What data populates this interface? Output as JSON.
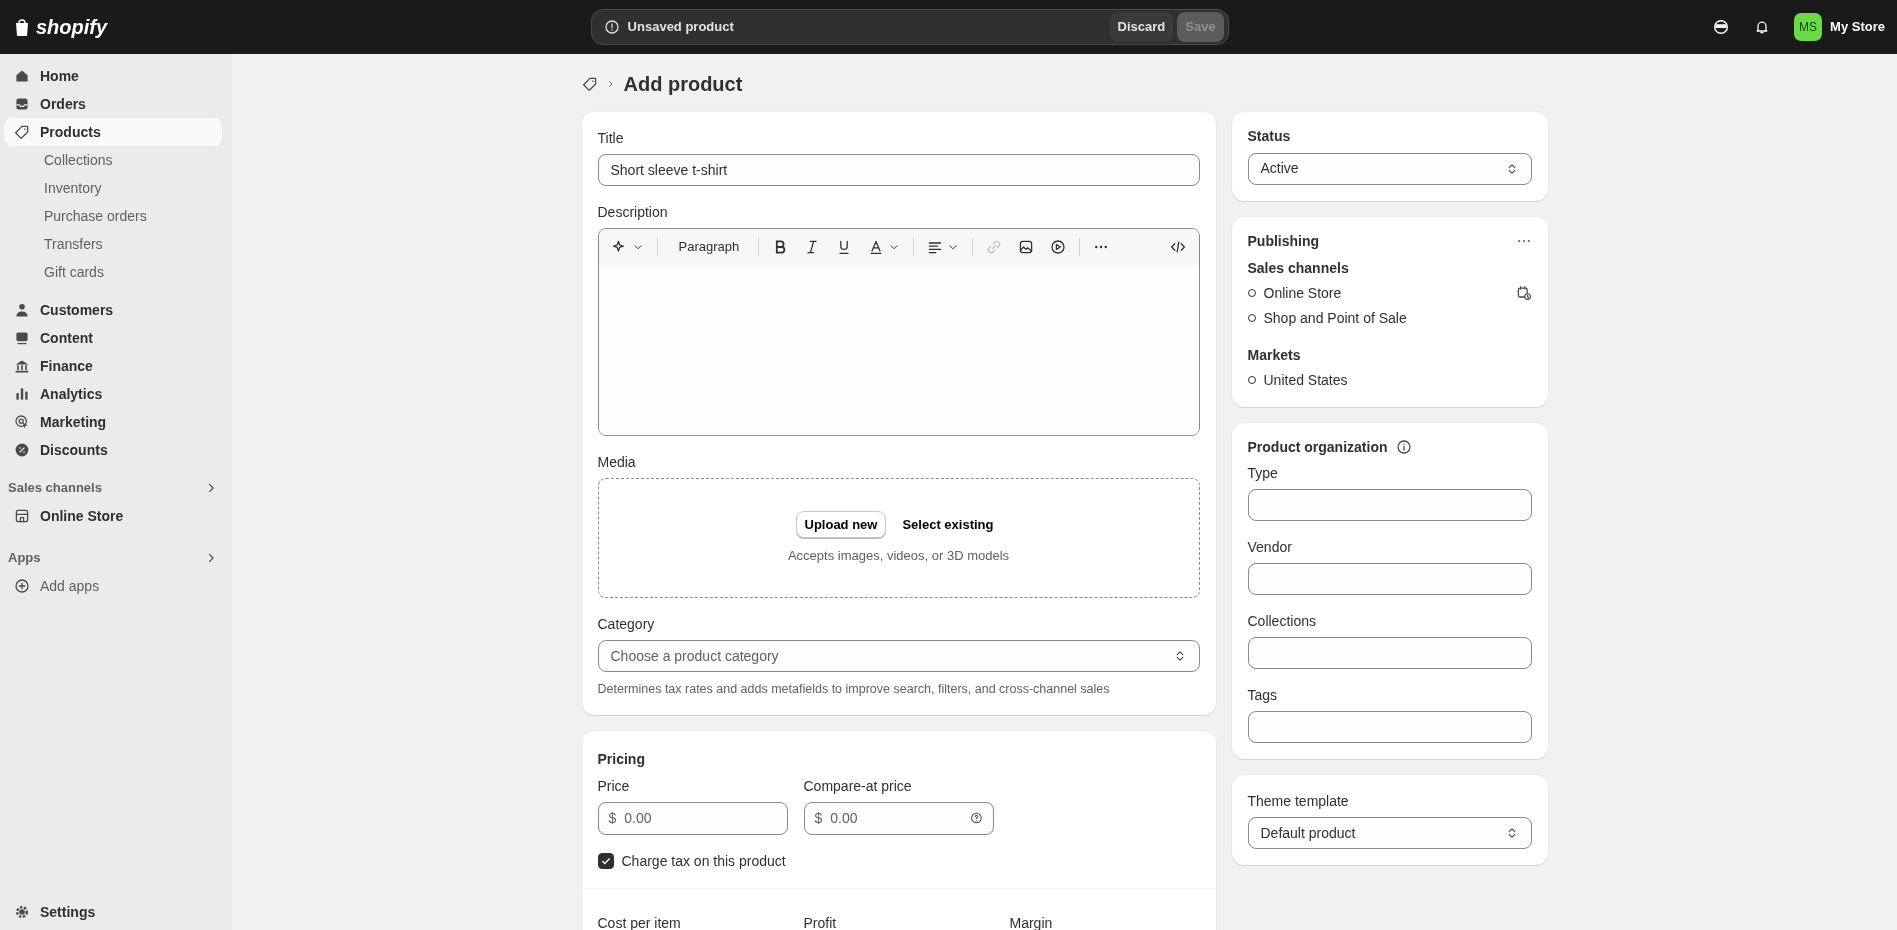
{
  "topbar": {
    "logo": "shopify",
    "unsaved": {
      "message": "Unsaved product",
      "discard": "Discard",
      "save": "Save",
      "save_disabled": true
    },
    "store": {
      "initials": "MS",
      "name": "My Store"
    }
  },
  "sidebar": {
    "items": [
      {
        "label": "Home",
        "kind": "main",
        "selected": false
      },
      {
        "label": "Orders",
        "kind": "main",
        "selected": false
      },
      {
        "label": "Products",
        "kind": "main",
        "selected": true
      },
      {
        "label": "Collections",
        "kind": "sub",
        "selected": false
      },
      {
        "label": "Inventory",
        "kind": "sub",
        "selected": false
      },
      {
        "label": "Purchase orders",
        "kind": "sub",
        "selected": false
      },
      {
        "label": "Transfers",
        "kind": "sub",
        "selected": false
      },
      {
        "label": "Gift cards",
        "kind": "sub",
        "selected": false
      },
      {
        "label": "Customers",
        "kind": "main",
        "selected": false
      },
      {
        "label": "Content",
        "kind": "main",
        "selected": false
      },
      {
        "label": "Finance",
        "kind": "main",
        "selected": false
      },
      {
        "label": "Analytics",
        "kind": "main",
        "selected": false
      },
      {
        "label": "Marketing",
        "kind": "main",
        "selected": false
      },
      {
        "label": "Discounts",
        "kind": "main",
        "selected": false
      }
    ],
    "sections": [
      {
        "title": "Sales channels",
        "items": [
          {
            "label": "Online Store",
            "kind": "channel"
          }
        ]
      },
      {
        "title": "Apps",
        "items": [
          {
            "label": "Add apps",
            "kind": "add"
          }
        ]
      }
    ],
    "settings": "Settings"
  },
  "page": {
    "title": "Add product"
  },
  "product": {
    "title": {
      "label": "Title",
      "value": "Short sleeve t-shirt"
    },
    "description": {
      "label": "Description",
      "format": "Paragraph",
      "link_disabled": true
    },
    "media": {
      "label": "Media",
      "upload": "Upload new",
      "select": "Select existing",
      "hint": "Accepts images, videos, or 3D models"
    },
    "category": {
      "label": "Category",
      "placeholder": "Choose a product category",
      "help": "Determines tax rates and adds metafields to improve search, filters, and cross-channel sales"
    }
  },
  "pricing": {
    "title": "Pricing",
    "price": {
      "label": "Price",
      "prefix": "$",
      "placeholder": "0.00"
    },
    "compare": {
      "label": "Compare-at price",
      "prefix": "$",
      "placeholder": "0.00"
    },
    "charge_tax": {
      "label": "Charge tax on this product",
      "checked": true
    },
    "cost_row": [
      {
        "label": "Cost per item"
      },
      {
        "label": "Profit"
      },
      {
        "label": "Margin"
      }
    ]
  },
  "status": {
    "label": "Status",
    "value": "Active"
  },
  "publishing": {
    "title": "Publishing",
    "channels_label": "Sales channels",
    "channels": [
      "Online Store",
      "Shop and Point of Sale"
    ],
    "markets_label": "Markets",
    "markets": [
      "United States"
    ]
  },
  "organization": {
    "title": "Product organization",
    "fields": [
      {
        "label": "Type"
      },
      {
        "label": "Vendor"
      },
      {
        "label": "Collections"
      },
      {
        "label": "Tags"
      }
    ]
  },
  "theme": {
    "label": "Theme template",
    "value": "Default product"
  }
}
